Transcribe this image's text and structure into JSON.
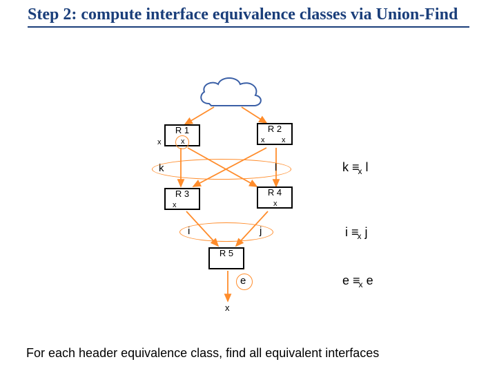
{
  "title": "Step 2: compute interface equivalence classes via Union-Find",
  "routers": {
    "r1": "R 1",
    "r2": "R 2",
    "r3": "R 3",
    "r4": "R 4",
    "r5": "R 5"
  },
  "x": "x",
  "iface": {
    "k": "k",
    "l": "l",
    "i": "i",
    "j": "j",
    "e": "e"
  },
  "equiv": {
    "kl": {
      "lhs": "k",
      "rhs": "l",
      "sym": "≡",
      "sub": "x"
    },
    "ij": {
      "lhs": "i",
      "rhs": "j",
      "sym": "≡",
      "sub": "x"
    },
    "ee": {
      "lhs": "e",
      "rhs": "e",
      "sym": "≡",
      "sub": "x"
    }
  },
  "caption": "For each header equivalence class, find all equivalent interfaces"
}
